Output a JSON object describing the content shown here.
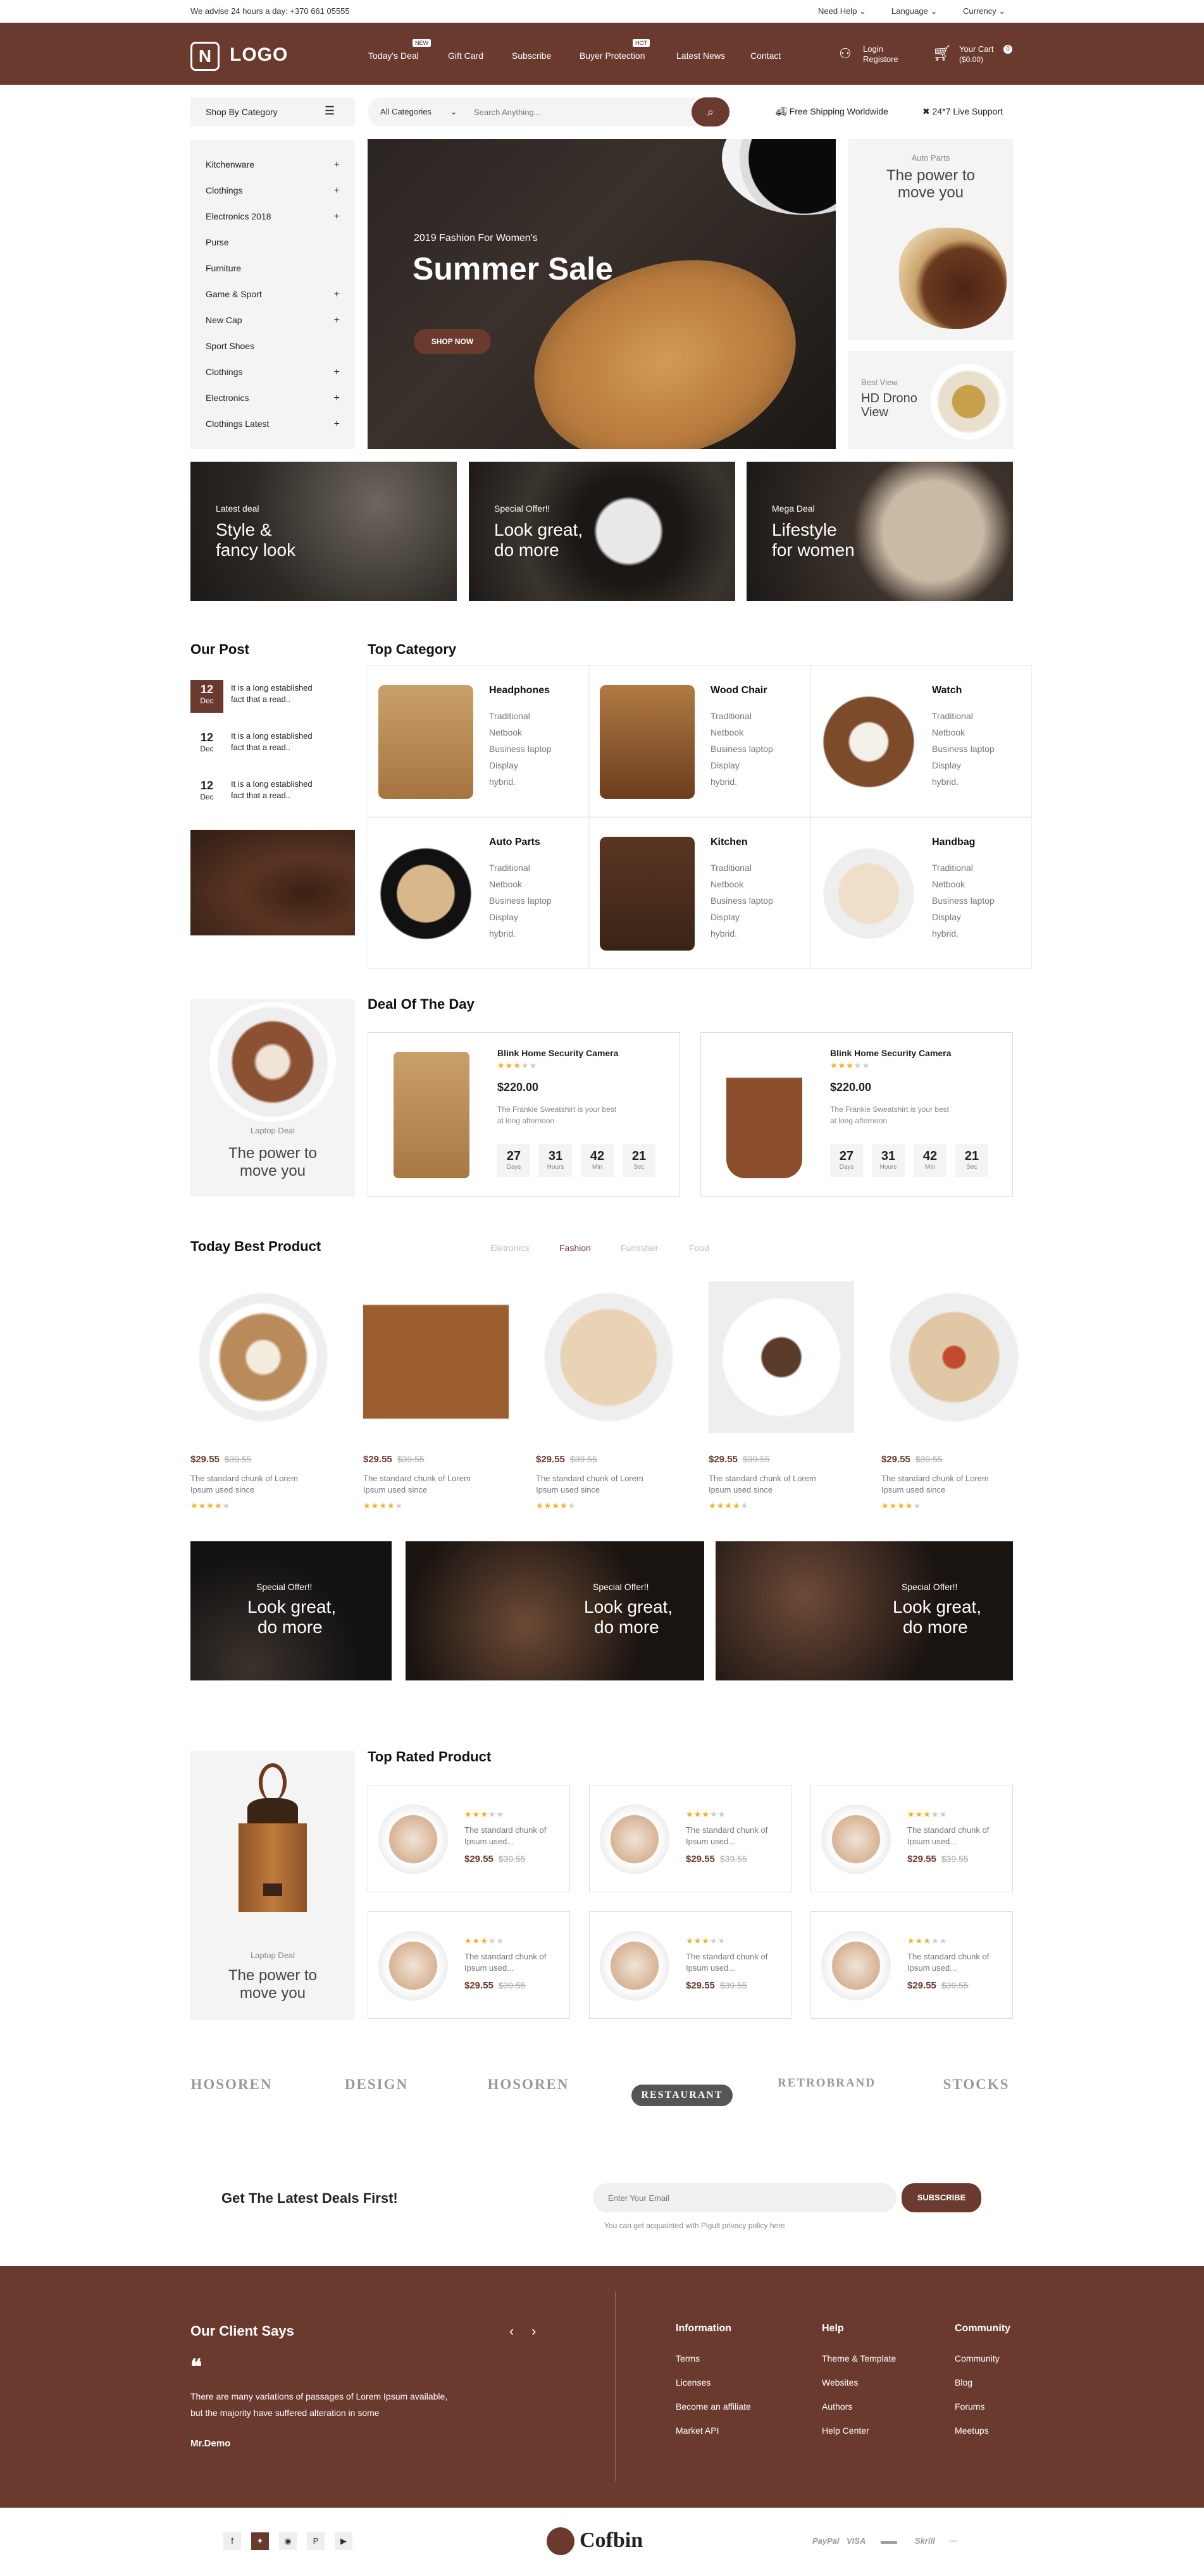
{
  "topbar": {
    "advise": "We advise 24 hours a day: +370 661 05555",
    "need_help": "Need Help",
    "language": "Language",
    "currency": "Currency"
  },
  "header": {
    "logo_letter": "N",
    "logo_text": "LOGO",
    "nav": [
      {
        "label": "Today's Deal",
        "badge": "NEW"
      },
      {
        "label": "Gift Card",
        "badge": ""
      },
      {
        "label": "Subscribe",
        "badge": ""
      },
      {
        "label": "Buyer Protection",
        "badge": "HOT"
      },
      {
        "label": "Latest News",
        "badge": ""
      },
      {
        "label": "Contact",
        "badge": ""
      }
    ],
    "login": "Login",
    "register": "Registore",
    "cart_label": "Your Cart",
    "cart_count": "0",
    "cart_total": "($0.00)"
  },
  "searchbar": {
    "shop_by_category": "Shop By Category",
    "all_categories": "All Categories",
    "placeholder": "Search Anything...",
    "free_shipping": "Free Shipping Worldwide",
    "support": "24*7 Live Support"
  },
  "sidebar": {
    "items": [
      {
        "label": "Kitchenware",
        "plus": "+"
      },
      {
        "label": "Clothings",
        "plus": "+"
      },
      {
        "label": "Electronics 2018",
        "plus": "+"
      },
      {
        "label": "Purse",
        "plus": ""
      },
      {
        "label": "Furniture",
        "plus": ""
      },
      {
        "label": "Game & Sport",
        "plus": "+"
      },
      {
        "label": "New Cap",
        "plus": "+"
      },
      {
        "label": "Sport Shoes",
        "plus": ""
      },
      {
        "label": "Clothings",
        "plus": "+"
      },
      {
        "label": "Electronics",
        "plus": "+"
      },
      {
        "label": "Clothings Latest",
        "plus": "+"
      }
    ]
  },
  "hero": {
    "subtitle": "2019 Fashion For Women's",
    "title": "Summer Sale",
    "button": "SHOP NOW"
  },
  "side_banners": [
    {
      "tag": "Auto Parts",
      "title": "The power to move you"
    },
    {
      "tag": "Best View",
      "title": "HD Drono View"
    }
  ],
  "promo_banners": [
    {
      "tag": "Latest deal",
      "title1": "Style &",
      "title2": "fancy look"
    },
    {
      "tag": "Special Offer!!",
      "title1": "Look great,",
      "title2": "do more"
    },
    {
      "tag": "Mega Deal",
      "title1": "Lifestyle",
      "title2": "for women"
    }
  ],
  "our_post": {
    "title": "Our Post",
    "posts": [
      {
        "day": "12",
        "month": "Dec",
        "text1": "It is a long established",
        "text2": "fact that a read.."
      },
      {
        "day": "12",
        "month": "Dec",
        "text1": "It is a long established",
        "text2": "fact that a read.."
      },
      {
        "day": "12",
        "month": "Dec",
        "text1": "It is a long established",
        "text2": "fact that a read.."
      }
    ]
  },
  "top_category": {
    "title": "Top Category",
    "subitems": [
      "Traditional",
      "Netbook",
      "Business laptop",
      "Display",
      "hybrid."
    ],
    "items": [
      {
        "name": "Headphones"
      },
      {
        "name": "Wood Chair"
      },
      {
        "name": "Watch"
      },
      {
        "name": "Auto Parts"
      },
      {
        "name": "Kitchen"
      },
      {
        "name": "Handbag"
      }
    ]
  },
  "deal_side": {
    "tag": "Laptop Deal",
    "title1": "The power to",
    "title2": "move you"
  },
  "deal_of_day": {
    "title": "Deal Of The Day",
    "items": [
      {
        "name": "Blink Home Security Camera",
        "price": "$220.00",
        "desc1": "The Frankie Sweatshirt is your best",
        "desc2": "at long afternoon"
      },
      {
        "name": "Blink Home Security Camera",
        "price": "$220.00",
        "desc1": "The Frankie Sweatshirt is your best",
        "desc2": "at long afternoon"
      }
    ],
    "countdown": [
      {
        "n": "27",
        "l": "Days"
      },
      {
        "n": "31",
        "l": "Hours"
      },
      {
        "n": "42",
        "l": "Min"
      },
      {
        "n": "21",
        "l": "Sec"
      }
    ]
  },
  "best_product": {
    "title": "Today Best Product",
    "tabs": [
      "Eletronics",
      "Fashion",
      "Furnisher",
      "Food"
    ],
    "price": "$29.55",
    "old_price": "$39.55",
    "desc1": "The standard chunk of Lorem",
    "desc2": "Ipsum used since"
  },
  "offer_banners": [
    {
      "tag": "Special Offer!!",
      "title1": "Look great,",
      "title2": "do more"
    },
    {
      "tag": "Special Offer!!",
      "title1": "Look great,",
      "title2": "do more"
    },
    {
      "tag": "Special Offer!!",
      "title1": "Look great,",
      "title2": "do more"
    }
  ],
  "rated_side": {
    "tag": "Laptop Deal",
    "title1": "The power to",
    "title2": "move you"
  },
  "top_rated": {
    "title": "Top Rated Product",
    "desc1": "The standard chunk of",
    "desc2": "Ipsum used...",
    "price": "$29.55",
    "old_price": "$39.55"
  },
  "brands": [
    "HOSOREN",
    "DESIGN",
    "HOSOREN",
    "RESTAURANT",
    "RETROBRAND",
    "STOCKS"
  ],
  "newsletter": {
    "title": "Get The Latest Deals First!",
    "placeholder": "Enter Your Email",
    "button": "SUBSCRIBE",
    "note": "You can get acquainted with Pigult privacy policy here"
  },
  "footer": {
    "client_title": "Our Client Says",
    "quote_mark": "❝",
    "testimonial1": "There are many variations of passages of Lorem Ipsum available,",
    "testimonial2": "but the majority have suffered alteration in some",
    "author": "Mr.Demo",
    "information": {
      "title": "Information",
      "links": [
        "Terms",
        "Licenses",
        "Become an affiliate",
        "Market API"
      ]
    },
    "help": {
      "title": "Help",
      "links": [
        "Theme & Template",
        "Websites",
        "Authors",
        "Help Center"
      ]
    },
    "community": {
      "title": "Community",
      "links": [
        "Community",
        "Blog",
        "Forums",
        "Meetups"
      ]
    }
  },
  "bottom": {
    "brand": "Cofbin",
    "payments": [
      "PayPal",
      "VISA",
      "▬▬",
      "Skrill",
      "◦◦◦"
    ]
  },
  "colors": {
    "brand": "#6b3a2e",
    "star": "#f2b01e"
  }
}
